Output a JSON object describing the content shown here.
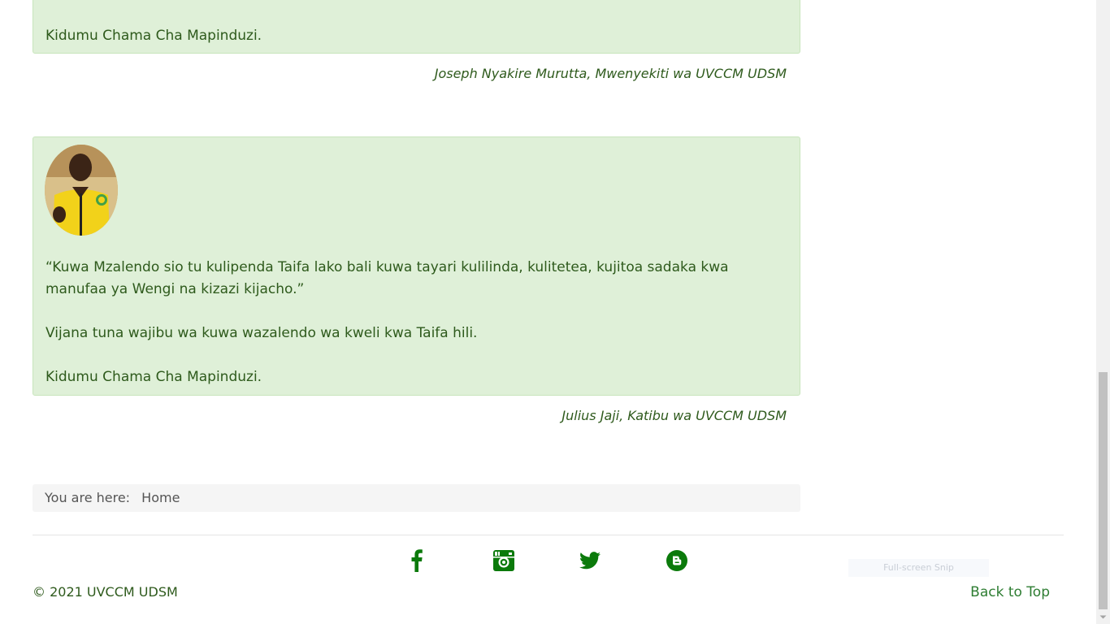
{
  "testimonials": [
    {
      "closing": "Kidumu Chama Cha Mapinduzi.",
      "author": "Joseph Nyakire Murutta, Mwenyekiti wa UVCCM UDSM"
    },
    {
      "quote": "“Kuwa Mzalendo sio tu kulipenda Taifa lako bali kuwa tayari kulilinda, kulitetea, kujitoa sadaka kwa manufaa ya Wengi na kizazi kijacho.”",
      "line2": "Vijana tuna wajibu wa kuwa wazalendo wa kweli kwa Taifa hili.",
      "closing": "Kidumu Chama Cha Mapinduzi.",
      "author": "Julius Jaji, Katibu wa UVCCM UDSM"
    }
  ],
  "breadcrumb": {
    "label": "You are here:",
    "home": "Home"
  },
  "social": [
    {
      "icon": "facebook-icon"
    },
    {
      "icon": "instagram-icon"
    },
    {
      "icon": "twitter-icon"
    },
    {
      "icon": "blogger-icon"
    }
  ],
  "footer": {
    "copyright": "© 2021 UVCCM UDSM",
    "back_to_top": "Back to Top"
  },
  "overlay": {
    "snip_label": "Full-screen Snip"
  },
  "colors": {
    "accent": "#0b7a0b",
    "box_bg": "#dff0d8",
    "text": "#2e5a1c"
  }
}
